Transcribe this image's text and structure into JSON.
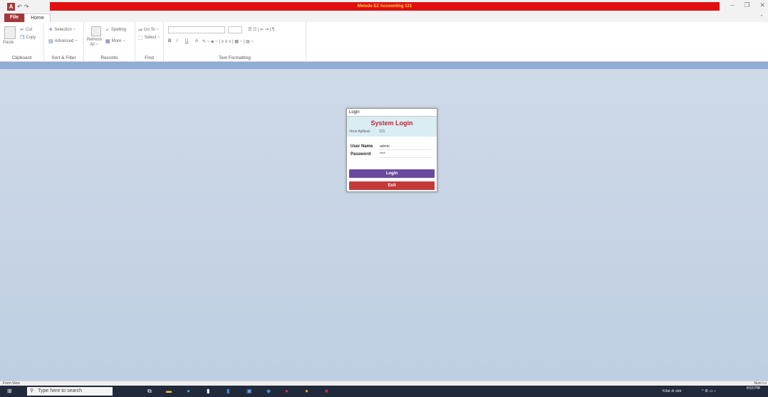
{
  "titlebar": {
    "app_icon": "A",
    "undo_icon": "↶",
    "redo_icon": "↷",
    "title": "Metode EZ Accounting 121",
    "minimize": "–",
    "restore": "❐",
    "close": "✕"
  },
  "tabs": [
    {
      "label": "File"
    },
    {
      "label": "Home"
    }
  ],
  "ribbon": {
    "collapse_icon": "⌃",
    "clipboard": {
      "paste": "Paste",
      "cut": "Cut",
      "copy": "Copy",
      "label": "Clipboard"
    },
    "sort_filter": {
      "selection": "Selection ~",
      "advanced": "Advanced ~",
      "label": "Sort & Filter"
    },
    "records": {
      "refresh": "Refresh",
      "refresh_all": "All ~",
      "spelling": "Spelling",
      "more": "More ~",
      "label": "Records"
    },
    "find": {
      "goto": "Go To ~",
      "select": "Select ~",
      "label": "Find"
    },
    "text_formatting": {
      "bold": "B",
      "italic": "I",
      "underline": "U",
      "font_color": "A",
      "label": "Text Formatting"
    }
  },
  "login": {
    "caption": "Login",
    "heading": "System Login",
    "version_label": "Versi Aplikasi",
    "version_value": "121",
    "username_label": "User Name",
    "username_value": "admin",
    "password_label": "Password",
    "password_value": "****",
    "login_button": "Login",
    "exit_button": "Exit"
  },
  "statusbar": {
    "left": "Form View",
    "right": "Num Lo"
  },
  "taskbar": {
    "start_icon": "⊞",
    "search_icon": "⚲",
    "search_placeholder": "Type here to search",
    "weather": "Kilat di sktr",
    "time": "8:53 PM",
    "colors": {
      "taskbar": "#202a3a",
      "accent": "#a4373a",
      "login_button": "#6a4a9e",
      "exit_button": "#c43a3a"
    }
  }
}
